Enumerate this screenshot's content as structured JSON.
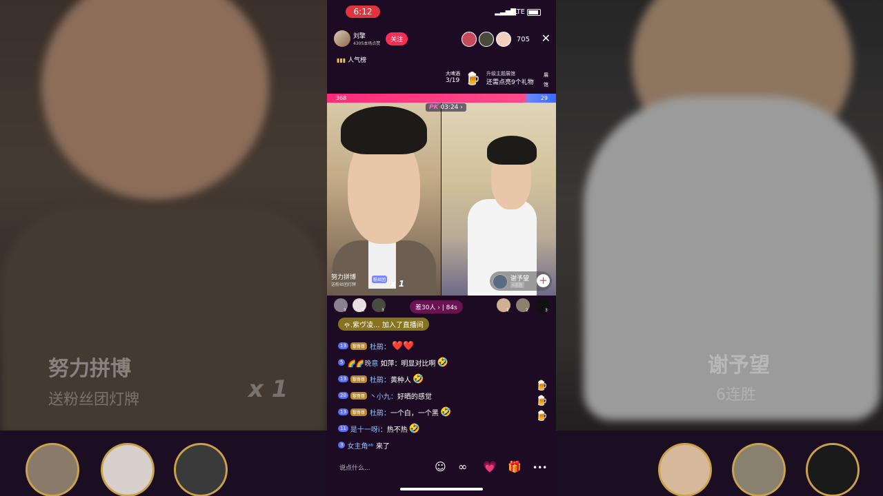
{
  "status": {
    "time": "6:12",
    "signal": "▂▃▅▇",
    "network": "LTE"
  },
  "host": {
    "name": "刘擎",
    "likes": "4305本场点赞",
    "follow_label": "关注"
  },
  "viewer_count": "705",
  "close_glyph": "✕",
  "rank_label": "人气榜",
  "rank_icon": "▮▮▮",
  "event": {
    "title": "大啤酒",
    "progress": "3/19",
    "icon": "🍺",
    "line1": "升级主题展馆",
    "line2": "还需点亮9个礼物",
    "side": "展馆"
  },
  "pk": {
    "left_score": "368",
    "right_score": "29",
    "timer": "03:24 ›",
    "pk_label": "PK"
  },
  "left_streamer": {
    "name": "努力拼博",
    "sub": "送粉丝团灯牌",
    "badge": "粉丝团",
    "multiplier": "x 1"
  },
  "right_streamer": {
    "name": "谢予望",
    "wins": "6连胜",
    "plus": "+"
  },
  "diff": "差30人 › | 84s",
  "left_supporter_badges": [
    "3",
    "2",
    "3"
  ],
  "right_supporter_badges": [
    "1",
    "2",
    "3"
  ],
  "joined": "ゃ.紫ヴ凌... 加入了直播间",
  "chat": [
    {
      "level": "13",
      "tag": "黎哥哥",
      "user": "杜鹃：",
      "text": "",
      "emoji": "❤️❤️"
    },
    {
      "level": "5",
      "tag": "",
      "user": "🌈🌈晚意",
      "text": "如萍：明显对比啊",
      "emoji": "🤣"
    },
    {
      "level": "13",
      "tag": "黎哥哥",
      "user": "杜鹃：",
      "text": "黄种人",
      "emoji": "🤣"
    },
    {
      "level": "20",
      "tag": "黎哥哥",
      "user": "丶小九：",
      "text": "好晒的感觉",
      "emoji": ""
    },
    {
      "level": "13",
      "tag": "黎哥哥",
      "user": "杜鹃：",
      "text": "一个白，一个黑",
      "emoji": "🤣"
    },
    {
      "level": "11",
      "tag": "",
      "user": "是十一呀i：",
      "text": "热不热",
      "emoji": "🤣"
    },
    {
      "level": "3",
      "tag": "",
      "user": "女主角ᵃᵇ",
      "text": "来了",
      "emoji": ""
    }
  ],
  "input_placeholder": "说点什么...",
  "toolbar_icons": [
    "☺",
    "∞",
    "💗",
    "🎁",
    "•••"
  ]
}
